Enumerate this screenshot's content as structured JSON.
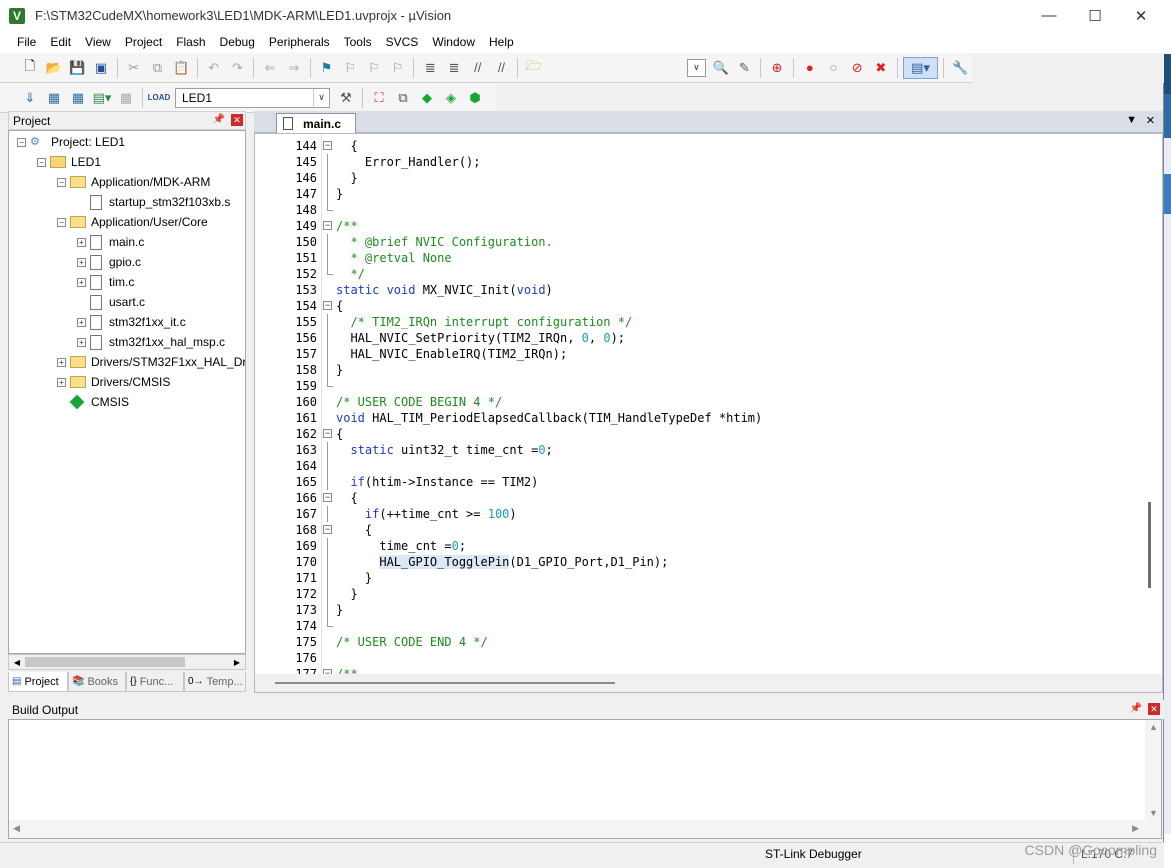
{
  "window": {
    "title": "F:\\STM32CudeMX\\homework3\\LED1\\MDK-ARM\\LED1.uvprojx - µVision"
  },
  "menu": [
    "File",
    "Edit",
    "View",
    "Project",
    "Flash",
    "Debug",
    "Peripherals",
    "Tools",
    "SVCS",
    "Window",
    "Help"
  ],
  "toolbar": {
    "target": "LED1"
  },
  "project_panel": {
    "title": "Project",
    "tree": [
      {
        "label": "Project: LED1",
        "depth": 0,
        "kind": "root",
        "exp": "-"
      },
      {
        "label": "LED1",
        "depth": 1,
        "kind": "target",
        "exp": "-"
      },
      {
        "label": "Application/MDK-ARM",
        "depth": 2,
        "kind": "folder",
        "exp": "-"
      },
      {
        "label": "startup_stm32f103xb.s",
        "depth": 3,
        "kind": "file",
        "exp": ""
      },
      {
        "label": "Application/User/Core",
        "depth": 2,
        "kind": "folder",
        "exp": "-"
      },
      {
        "label": "main.c",
        "depth": 3,
        "kind": "file",
        "exp": "+"
      },
      {
        "label": "gpio.c",
        "depth": 3,
        "kind": "file",
        "exp": "+"
      },
      {
        "label": "tim.c",
        "depth": 3,
        "kind": "file",
        "exp": "+"
      },
      {
        "label": "usart.c",
        "depth": 3,
        "kind": "file",
        "exp": ""
      },
      {
        "label": "stm32f1xx_it.c",
        "depth": 3,
        "kind": "file",
        "exp": "+"
      },
      {
        "label": "stm32f1xx_hal_msp.c",
        "depth": 3,
        "kind": "file",
        "exp": "+"
      },
      {
        "label": "Drivers/STM32F1xx_HAL_Driv",
        "depth": 2,
        "kind": "folder",
        "exp": "+"
      },
      {
        "label": "Drivers/CMSIS",
        "depth": 2,
        "kind": "folder",
        "exp": "+"
      },
      {
        "label": "CMSIS",
        "depth": 2,
        "kind": "cmsis",
        "exp": ""
      }
    ],
    "tabs": [
      "Project",
      "Books",
      "Func...",
      "Temp..."
    ]
  },
  "editor": {
    "tab": "main.c",
    "lines": [
      {
        "n": "144",
        "f": "box-",
        "t": [
          [
            "",
            "  {"
          ]
        ]
      },
      {
        "n": "145",
        "f": "line",
        "t": [
          [
            "",
            "    Error_Handler();"
          ]
        ]
      },
      {
        "n": "146",
        "f": "line",
        "t": [
          [
            "",
            "  }"
          ]
        ]
      },
      {
        "n": "147",
        "f": "line",
        "t": [
          [
            "",
            "}"
          ]
        ]
      },
      {
        "n": "148",
        "f": "end",
        "t": [
          [
            "",
            ""
          ]
        ]
      },
      {
        "n": "149",
        "f": "box-",
        "t": [
          [
            "cm",
            "/**"
          ]
        ]
      },
      {
        "n": "150",
        "f": "line",
        "t": [
          [
            "cm",
            "  * @brief NVIC Configuration."
          ]
        ]
      },
      {
        "n": "151",
        "f": "line",
        "t": [
          [
            "cm",
            "  * @retval None"
          ]
        ]
      },
      {
        "n": "152",
        "f": "end",
        "t": [
          [
            "cm",
            "  */"
          ]
        ]
      },
      {
        "n": "153",
        "f": "",
        "t": [
          [
            "kw",
            "static void"
          ],
          [
            "",
            " MX_NVIC_Init("
          ],
          [
            "kw",
            "void"
          ],
          [
            "",
            ")"
          ]
        ]
      },
      {
        "n": "154",
        "f": "box-",
        "t": [
          [
            "",
            "{"
          ]
        ]
      },
      {
        "n": "155",
        "f": "line",
        "t": [
          [
            "cm",
            "  /* TIM2_IRQn interrupt configuration */"
          ]
        ]
      },
      {
        "n": "156",
        "f": "line",
        "t": [
          [
            "",
            "  HAL_NVIC_SetPriority(TIM2_IRQn, "
          ],
          [
            "num",
            "0"
          ],
          [
            "",
            ", "
          ],
          [
            "num",
            "0"
          ],
          [
            "",
            ");"
          ]
        ]
      },
      {
        "n": "157",
        "f": "line",
        "t": [
          [
            "",
            "  HAL_NVIC_EnableIRQ(TIM2_IRQn);"
          ]
        ]
      },
      {
        "n": "158",
        "f": "line",
        "t": [
          [
            "",
            "}"
          ]
        ]
      },
      {
        "n": "159",
        "f": "end",
        "t": [
          [
            "",
            ""
          ]
        ]
      },
      {
        "n": "160",
        "f": "",
        "t": [
          [
            "cm",
            "/* USER CODE BEGIN 4 */"
          ]
        ]
      },
      {
        "n": "161",
        "f": "",
        "t": [
          [
            "kw",
            "void"
          ],
          [
            "",
            " HAL_TIM_PeriodElapsedCallback(TIM_HandleTypeDef *htim)"
          ]
        ]
      },
      {
        "n": "162",
        "f": "box-",
        "t": [
          [
            "",
            "{"
          ]
        ]
      },
      {
        "n": "163",
        "f": "line",
        "t": [
          [
            "",
            "  "
          ],
          [
            "kw",
            "static"
          ],
          [
            "",
            " uint32_t time_cnt ="
          ],
          [
            "num",
            "0"
          ],
          [
            "",
            ";"
          ]
        ]
      },
      {
        "n": "164",
        "f": "line",
        "t": [
          [
            "",
            ""
          ]
        ]
      },
      {
        "n": "165",
        "f": "line",
        "t": [
          [
            "",
            "  "
          ],
          [
            "kw",
            "if"
          ],
          [
            "",
            "(htim->Instance == TIM2)"
          ]
        ]
      },
      {
        "n": "166",
        "f": "box-",
        "t": [
          [
            "",
            "  {"
          ]
        ]
      },
      {
        "n": "167",
        "f": "line",
        "t": [
          [
            "",
            "    "
          ],
          [
            "kw",
            "if"
          ],
          [
            "",
            "(++time_cnt >= "
          ],
          [
            "num",
            "100"
          ],
          [
            "",
            ")"
          ]
        ]
      },
      {
        "n": "168",
        "f": "box-",
        "t": [
          [
            "",
            "    {"
          ]
        ]
      },
      {
        "n": "169",
        "f": "line",
        "t": [
          [
            "",
            "      time_cnt ="
          ],
          [
            "num",
            "0"
          ],
          [
            "",
            ";"
          ]
        ]
      },
      {
        "n": "170",
        "f": "line",
        "t": [
          [
            "",
            "      "
          ],
          [
            "hl",
            "HAL_GPIO_TogglePin"
          ],
          [
            "",
            "(D1_GPIO_Port,D1_Pin);"
          ]
        ]
      },
      {
        "n": "171",
        "f": "line",
        "t": [
          [
            "",
            "    }"
          ]
        ]
      },
      {
        "n": "172",
        "f": "line",
        "t": [
          [
            "",
            "  }"
          ]
        ]
      },
      {
        "n": "173",
        "f": "line",
        "t": [
          [
            "",
            "}"
          ]
        ]
      },
      {
        "n": "174",
        "f": "end",
        "t": [
          [
            "",
            ""
          ]
        ]
      },
      {
        "n": "175",
        "f": "",
        "t": [
          [
            "cm",
            "/* USER CODE END 4 */"
          ]
        ]
      },
      {
        "n": "176",
        "f": "",
        "t": [
          [
            "",
            ""
          ]
        ]
      },
      {
        "n": "177",
        "f": "box-",
        "t": [
          [
            "cm",
            "/**"
          ]
        ]
      }
    ]
  },
  "build_output": {
    "title": "Build Output"
  },
  "status": {
    "debugger": "ST-Link Debugger",
    "position": "L:170 C:7"
  },
  "watermark": "CSDN @Gocompling"
}
